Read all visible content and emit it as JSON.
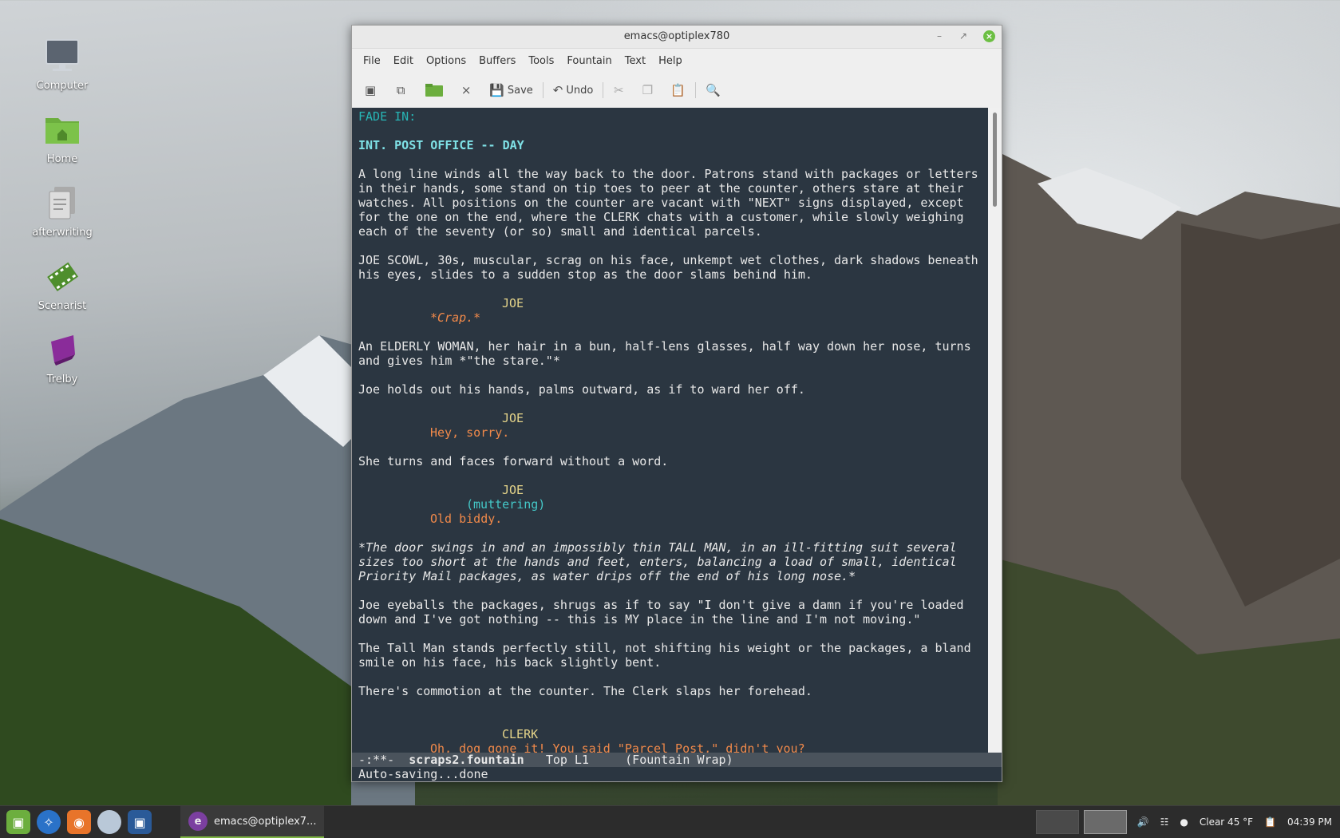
{
  "desktop": {
    "icons": [
      {
        "label": "Computer"
      },
      {
        "label": "Home"
      },
      {
        "label": "afterwriting"
      },
      {
        "label": "Scenarist"
      },
      {
        "label": "Trelby"
      }
    ]
  },
  "window": {
    "title": "emacs@optiplex780",
    "menu": [
      "File",
      "Edit",
      "Options",
      "Buffers",
      "Tools",
      "Fountain",
      "Text",
      "Help"
    ],
    "toolbar": {
      "save_label": "Save",
      "undo_label": "Undo"
    }
  },
  "editor": {
    "lines": [
      {
        "text": "FADE IN:",
        "style": "fade"
      },
      {
        "text": "INT. POST OFFICE -- DAY",
        "style": "heading"
      },
      {
        "text": "A long line winds all the way back to the door. Patrons stand with packages or letters",
        "style": "action"
      },
      {
        "text": "in their hands, some stand on tip toes to peer at the counter, others stare at their",
        "style": "action"
      },
      {
        "text": "watches. All positions on the counter are vacant with \"NEXT\" signs displayed, except",
        "style": "action"
      },
      {
        "text": "for the one on the end, where the CLERK chats with a customer, while slowly weighing",
        "style": "action"
      },
      {
        "text": "each of the seventy (or so) small and identical parcels.",
        "style": "action"
      },
      {
        "text": "JOE SCOWL, 30s, muscular, scrag on his face, unkempt wet clothes, dark shadows beneath",
        "style": "action"
      },
      {
        "text": "his eyes, slides to a sudden stop as the door slams behind him.",
        "style": "action"
      },
      {
        "text": "JOE",
        "style": "char"
      },
      {
        "text": "*Crap.*",
        "style": "dial-italic"
      },
      {
        "text": "An ELDERLY WOMAN, her hair in a bun, half-lens glasses, half way down her nose, turns",
        "style": "action"
      },
      {
        "text": "and gives him *\"the stare.\"*",
        "style": "action"
      },
      {
        "text": "Joe holds out his hands, palms outward, as if to ward her off.",
        "style": "action"
      },
      {
        "text": "JOE",
        "style": "char"
      },
      {
        "text": "Hey, sorry.",
        "style": "dial"
      },
      {
        "text": "She turns and faces forward without a word.",
        "style": "action"
      },
      {
        "text": "JOE",
        "style": "char"
      },
      {
        "text": "(muttering)",
        "style": "paren"
      },
      {
        "text": "Old biddy.",
        "style": "dial"
      },
      {
        "text": "*The door swings in and an impossibly thin TALL MAN, in an ill-fitting suit several",
        "style": "italic"
      },
      {
        "text": "sizes too short at the hands and feet, enters, balancing a load of small, identical",
        "style": "italic"
      },
      {
        "text": "Priority Mail packages, as water drips off the end of his long nose.*",
        "style": "italic"
      },
      {
        "text": "Joe eyeballs the packages, shrugs as if to say \"I don't give a damn if you're loaded",
        "style": "action"
      },
      {
        "text": "down and I've got nothing -- this is MY place in the line and I'm not moving.\"",
        "style": "action"
      },
      {
        "text": "The Tall Man stands perfectly still, not shifting his weight or the packages, a bland",
        "style": "action"
      },
      {
        "text": "smile on his face, his back slightly bent.",
        "style": "action"
      },
      {
        "text": "There's commotion at the counter. The Clerk slaps her forehead.",
        "style": "action"
      },
      {
        "text": "CLERK",
        "style": "char"
      },
      {
        "text": "Oh, dog gone it! You said \"Parcel Post,\" didn't you?",
        "style": "dial"
      }
    ]
  },
  "modeline": {
    "status": "-:**-",
    "buffer": "scraps2.fountain",
    "position": "Top L1",
    "modes": "(Fountain Wrap)"
  },
  "minibuffer": "Auto-saving...done",
  "taskbar": {
    "task_label": "emacs@optiplex7...",
    "weather": "Clear 45 °F",
    "clock": "04:39 PM"
  }
}
